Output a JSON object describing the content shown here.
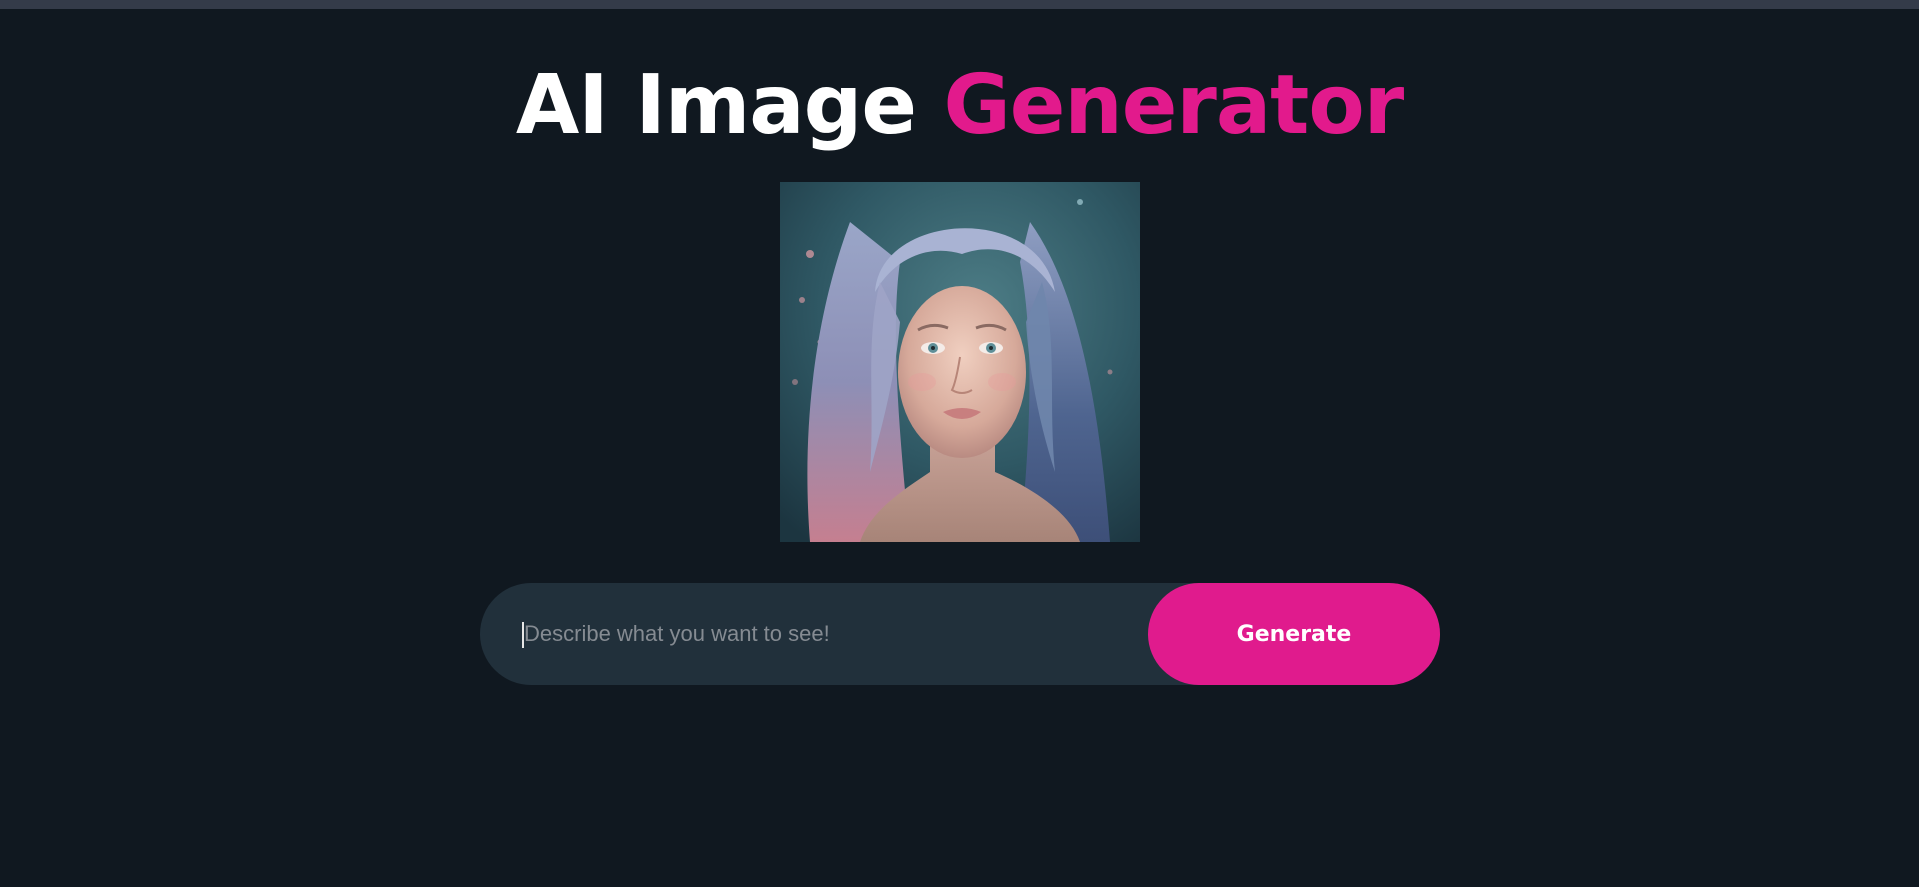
{
  "header": {
    "title_main": "AI Image",
    "title_accent": "Generator"
  },
  "image": {
    "alt": "Generated portrait"
  },
  "prompt": {
    "placeholder": "Describe what you want to see!",
    "value": ""
  },
  "generate": {
    "label": "Generate"
  },
  "colors": {
    "background": "#101820",
    "accent": "#e01b8d",
    "input_bg": "#21303b",
    "topbar": "#343b49"
  }
}
